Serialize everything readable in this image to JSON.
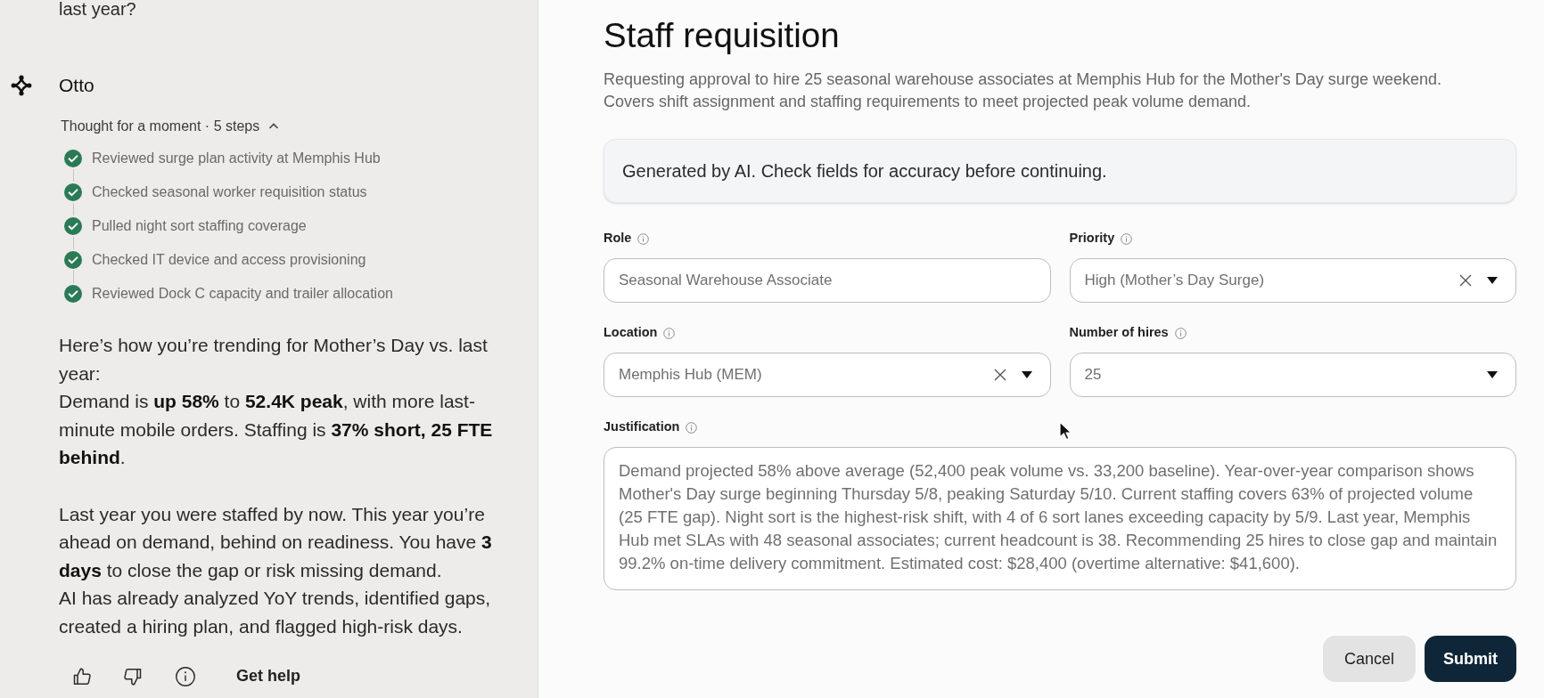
{
  "chat": {
    "previous_message_tail": "last year?",
    "assistant_name": "Otto",
    "thinking": {
      "summary": "Thought for a moment · 5 steps",
      "expanded": true,
      "steps": [
        {
          "label": "Reviewed surge plan activity at Memphis Hub",
          "done": true
        },
        {
          "label": "Checked seasonal worker requisition status",
          "done": true
        },
        {
          "label": "Pulled night sort staffing coverage",
          "done": true
        },
        {
          "label": "Checked IT device and access provisioning",
          "done": true
        },
        {
          "label": "Reviewed Dock C capacity and trailer allocation",
          "done": true
        }
      ]
    },
    "paragraphs": [
      [
        "Here’s how you’re trending for Mother’s Day vs. last year:",
        "Demand is **up 58%** to **52.4K peak**, with more last-minute mobile orders. Staffing is **37% short, 25 FTE behind**."
      ],
      [
        "Last year you were staffed by now. This year you’re ahead on demand, behind on readiness. You have **3 days** to close the gap or risk missing demand.",
        "AI has already analyzed YoY trends, identified gaps, created a hiring plan, and flagged high-risk days."
      ]
    ],
    "help_link": "Get help"
  },
  "form": {
    "title": "Staff requisition",
    "description": [
      "Requesting approval to hire 25 seasonal warehouse associates at Memphis Hub for the Mother's Day surge weekend.",
      "Covers shift assignment and staffing requirements to meet projected peak volume demand."
    ],
    "ai_notice": "Generated by AI. Check fields for accuracy before continuing.",
    "fields": [
      {
        "label": "Role",
        "kind": "text",
        "value": "Seasonal Warehouse Associate",
        "clearable": false
      },
      {
        "label": "Priority",
        "kind": "select",
        "value": "High (Mother’s Day Surge)",
        "clearable": true
      },
      {
        "label": "Location",
        "kind": "select",
        "value": "Memphis Hub (MEM)",
        "clearable": true
      },
      {
        "label": "Number of hires",
        "kind": "select",
        "value": "25",
        "clearable": false
      },
      {
        "label": "Justification",
        "kind": "textarea",
        "value": "Demand projected 58% above average (52,400 peak volume vs. 33,200 baseline). Year-over-year comparison shows Mother's Day surge beginning Thursday 5/8, peaking Saturday 5/10. Current staffing covers 63% of projected volume (25 FTE gap). Night sort is the highest-risk shift, with 4 of 6 sort lanes exceeding capacity by 5/9. Last year, Memphis Hub met SLAs with 48 seasonal associates; current headcount is 38. Recommending 25 hires to close gap and maintain 99.2% on-time delivery commitment. Estimated cost: $28,400 (overtime alternative: $41,600)."
      }
    ],
    "buttons": [
      {
        "label": "Cancel",
        "kind": "secondary"
      },
      {
        "label": "Submit",
        "kind": "primary"
      }
    ]
  }
}
